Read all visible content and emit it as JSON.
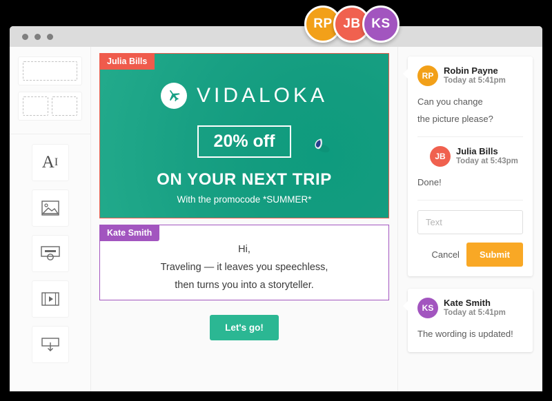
{
  "window": {
    "dots": [
      "close-dot",
      "minimize-dot",
      "maximize-dot"
    ]
  },
  "collaborators": [
    {
      "initials": "RP",
      "color": "#f2a019"
    },
    {
      "initials": "JB",
      "color": "#f0614f"
    },
    {
      "initials": "KS",
      "color": "#a255bf"
    }
  ],
  "sidebar": {
    "layouts": [
      {
        "name": "one-column-layout",
        "slots": 1
      },
      {
        "name": "two-column-layout",
        "slots": 2
      }
    ],
    "tools": [
      {
        "name": "text-tool",
        "label": "A",
        "sub": "I"
      },
      {
        "name": "image-tool",
        "label": ""
      },
      {
        "name": "button-tool",
        "label": ""
      },
      {
        "name": "video-tool",
        "label": ""
      },
      {
        "name": "divider-tool",
        "label": ""
      }
    ]
  },
  "canvas": {
    "hero": {
      "tag": "Julia Bills",
      "brand": "VIDALOKA",
      "offer": "20% off",
      "headline": "ON YOUR NEXT TRIP",
      "subline": "With the promocode *SUMMER*",
      "bg_color": "#16a085",
      "tag_color": "#ef5b4c"
    },
    "text_block": {
      "tag": "Kate Smith",
      "tag_color": "#a255bf",
      "line1": "Hi,",
      "line2": "Traveling — it leaves you speechless,",
      "line3": "then turns you into a storyteller."
    },
    "cta": {
      "label": "Let's go!",
      "color": "#2bb793"
    }
  },
  "comments": {
    "thread": [
      {
        "initials": "RP",
        "color": "#f2a019",
        "name": "Robin Payne",
        "time": "Today at 5:41pm",
        "line1": "Can you change",
        "line2": "the picture please?"
      },
      {
        "initials": "JB",
        "color": "#f0614f",
        "name": "Julia Bills",
        "time": "Today at 5:43pm",
        "line1": "Done!"
      }
    ],
    "reply": {
      "value": "",
      "placeholder": "Text",
      "cancel_label": "Cancel",
      "submit_label": "Submit",
      "submit_color": "#f9a825"
    },
    "standalone": {
      "initials": "KS",
      "color": "#a255bf",
      "name": "Kate Smith",
      "time": "Today at 5:41pm",
      "line1": "The wording is updated!"
    }
  }
}
